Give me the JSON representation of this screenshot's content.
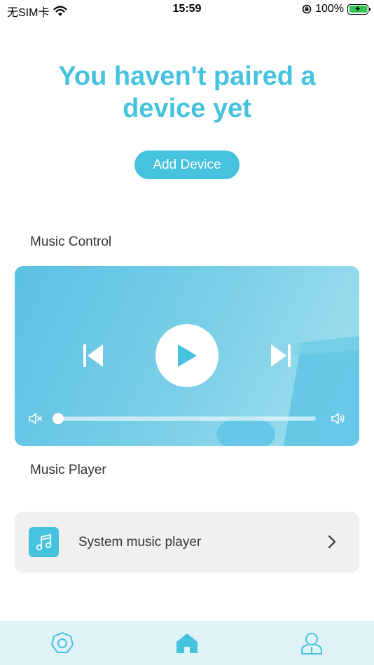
{
  "status_bar": {
    "carrier": "无SIM卡",
    "time": "15:59",
    "battery": "100%"
  },
  "main": {
    "title": "You haven't paired  a device yet",
    "add_device_label": "Add Device"
  },
  "music_control": {
    "section_label": "Music Control",
    "volume_level": 0.0,
    "icons": [
      "previous-icon",
      "play-icon",
      "next-icon",
      "mute-icon",
      "volume-icon"
    ]
  },
  "music_player": {
    "section_label": "Music Player",
    "system_player_label": "System music player"
  },
  "tab_bar": {
    "tabs": [
      "devices",
      "home",
      "profile"
    ],
    "active": "home"
  },
  "colors": {
    "accent": "#45c2de",
    "tab_bar_bg": "#dff2f7",
    "row_bg": "#f0f0f0"
  }
}
